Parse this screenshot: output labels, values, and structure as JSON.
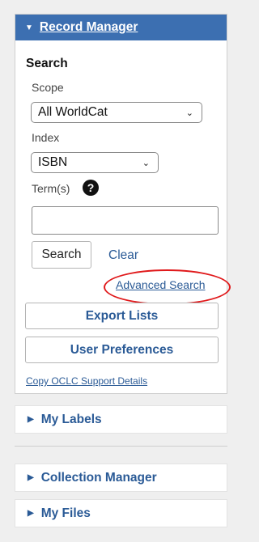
{
  "record_manager": {
    "title": "Record Manager",
    "search_heading": "Search",
    "scope_label": "Scope",
    "scope_value": "All WorldCat",
    "index_label": "Index",
    "index_value": "ISBN",
    "terms_label": "Term(s)",
    "terms_value": "",
    "help_glyph": "?",
    "search_button": "Search",
    "clear_link": "Clear",
    "advanced_search_link": "Advanced Search",
    "export_lists_button": "Export Lists",
    "user_preferences_button": "User Preferences",
    "copy_support_link": "Copy OCLC Support Details"
  },
  "panels": {
    "my_labels": "My Labels",
    "collection_manager": "Collection Manager",
    "my_files": "My Files"
  },
  "colors": {
    "header_bg": "#3c6fb1",
    "link": "#2a5a96",
    "highlight_circle": "#e0191b"
  }
}
